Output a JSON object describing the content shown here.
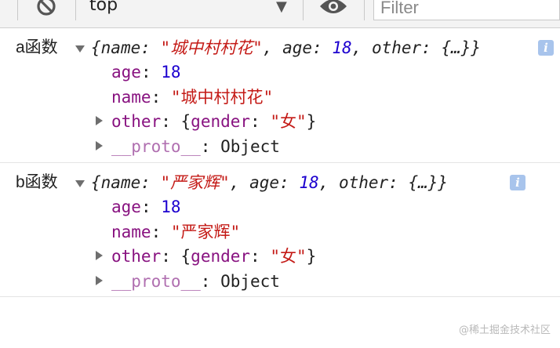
{
  "toolbar": {
    "context": "top",
    "filter_placeholder": "Filter"
  },
  "entries": [
    {
      "label": "a函数",
      "summary": {
        "open": "{",
        "name_key": "name",
        "name_val": "\"城中村村花\"",
        "age_key": "age",
        "age_val": "18",
        "other_key": "other",
        "other_val": "{…}",
        "close": "}"
      },
      "props": {
        "age_key": "age",
        "age_val": "18",
        "name_key": "name",
        "name_val": "\"城中村村花\"",
        "other_key": "other",
        "other_val_open": "{",
        "gender_key": "gender",
        "gender_val": "\"女\"",
        "other_val_close": "}",
        "proto_key": "__proto__",
        "proto_val": "Object"
      }
    },
    {
      "label": "b函数",
      "summary": {
        "open": "{",
        "name_key": "name",
        "name_val": "\"严家辉\"",
        "age_key": "age",
        "age_val": "18",
        "other_key": "other",
        "other_val": "{…}",
        "close": "}"
      },
      "props": {
        "age_key": "age",
        "age_val": "18",
        "name_key": "name",
        "name_val": "\"严家辉\"",
        "other_key": "other",
        "other_val_open": "{",
        "gender_key": "gender",
        "gender_val": "\"女\"",
        "other_val_close": "}",
        "proto_key": "__proto__",
        "proto_val": "Object"
      }
    }
  ],
  "info_glyph": "i",
  "watermark": "@稀土掘金技术社区",
  "colors": {
    "key": "#881280",
    "string": "#c41a16",
    "number": "#1c00cf",
    "info_badge": "#a8c4ec"
  }
}
